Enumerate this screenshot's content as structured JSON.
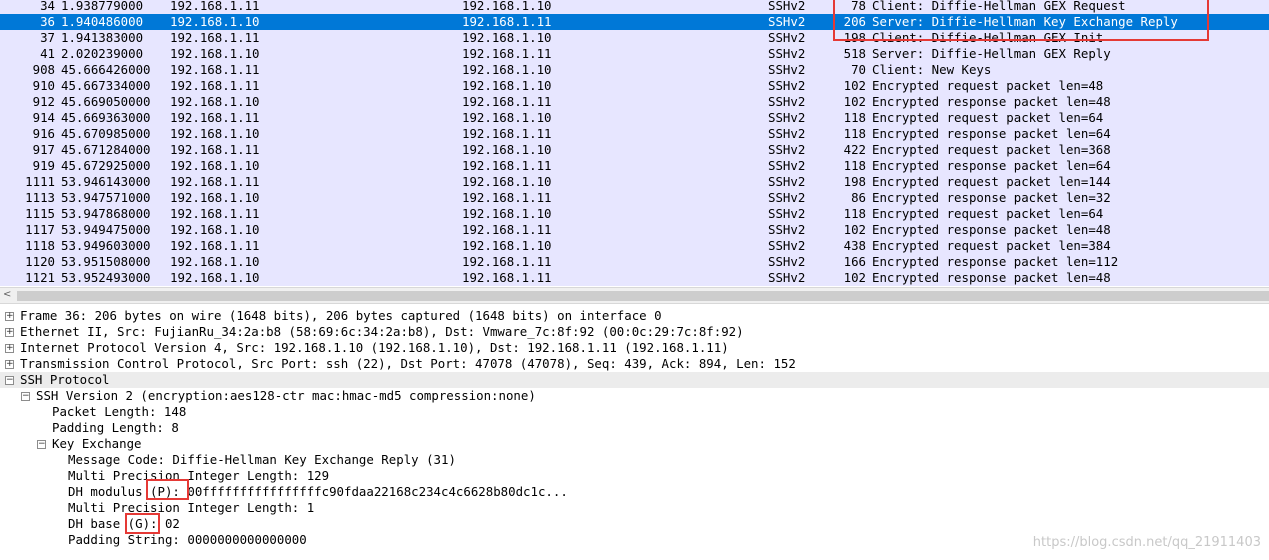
{
  "packets": [
    {
      "no": "34",
      "time": "1.938779000",
      "src": "192.168.1.11",
      "dst": "192.168.1.10",
      "proto": "SSHv2",
      "len": "78",
      "info": "Client: Diffie-Hellman GEX Request"
    },
    {
      "no": "36",
      "time": "1.940486000",
      "src": "192.168.1.10",
      "dst": "192.168.1.11",
      "proto": "SSHv2",
      "len": "206",
      "info": "Server: Diffie-Hellman Key Exchange Reply",
      "selected": true
    },
    {
      "no": "37",
      "time": "1.941383000",
      "src": "192.168.1.11",
      "dst": "192.168.1.10",
      "proto": "SSHv2",
      "len": "198",
      "info": "Client: Diffie-Hellman GEX Init"
    },
    {
      "no": "41",
      "time": "2.020239000",
      "src": "192.168.1.10",
      "dst": "192.168.1.11",
      "proto": "SSHv2",
      "len": "518",
      "info": "Server: Diffie-Hellman GEX Reply"
    },
    {
      "no": "908",
      "time": "45.666426000",
      "src": "192.168.1.11",
      "dst": "192.168.1.10",
      "proto": "SSHv2",
      "len": "70",
      "info": "Client: New Keys"
    },
    {
      "no": "910",
      "time": "45.667334000",
      "src": "192.168.1.11",
      "dst": "192.168.1.10",
      "proto": "SSHv2",
      "len": "102",
      "info": "Encrypted request packet len=48"
    },
    {
      "no": "912",
      "time": "45.669050000",
      "src": "192.168.1.10",
      "dst": "192.168.1.11",
      "proto": "SSHv2",
      "len": "102",
      "info": "Encrypted response packet len=48"
    },
    {
      "no": "914",
      "time": "45.669363000",
      "src": "192.168.1.11",
      "dst": "192.168.1.10",
      "proto": "SSHv2",
      "len": "118",
      "info": "Encrypted request packet len=64"
    },
    {
      "no": "916",
      "time": "45.670985000",
      "src": "192.168.1.10",
      "dst": "192.168.1.11",
      "proto": "SSHv2",
      "len": "118",
      "info": "Encrypted response packet len=64"
    },
    {
      "no": "917",
      "time": "45.671284000",
      "src": "192.168.1.11",
      "dst": "192.168.1.10",
      "proto": "SSHv2",
      "len": "422",
      "info": "Encrypted request packet len=368"
    },
    {
      "no": "919",
      "time": "45.672925000",
      "src": "192.168.1.10",
      "dst": "192.168.1.11",
      "proto": "SSHv2",
      "len": "118",
      "info": "Encrypted response packet len=64"
    },
    {
      "no": "1111",
      "time": "53.946143000",
      "src": "192.168.1.11",
      "dst": "192.168.1.10",
      "proto": "SSHv2",
      "len": "198",
      "info": "Encrypted request packet len=144"
    },
    {
      "no": "1113",
      "time": "53.947571000",
      "src": "192.168.1.10",
      "dst": "192.168.1.11",
      "proto": "SSHv2",
      "len": "86",
      "info": "Encrypted response packet len=32"
    },
    {
      "no": "1115",
      "time": "53.947868000",
      "src": "192.168.1.11",
      "dst": "192.168.1.10",
      "proto": "SSHv2",
      "len": "118",
      "info": "Encrypted request packet len=64"
    },
    {
      "no": "1117",
      "time": "53.949475000",
      "src": "192.168.1.10",
      "dst": "192.168.1.11",
      "proto": "SSHv2",
      "len": "102",
      "info": "Encrypted response packet len=48"
    },
    {
      "no": "1118",
      "time": "53.949603000",
      "src": "192.168.1.11",
      "dst": "192.168.1.10",
      "proto": "SSHv2",
      "len": "438",
      "info": "Encrypted request packet len=384"
    },
    {
      "no": "1120",
      "time": "53.951508000",
      "src": "192.168.1.10",
      "dst": "192.168.1.11",
      "proto": "SSHv2",
      "len": "166",
      "info": "Encrypted response packet len=112"
    },
    {
      "no": "1121",
      "time": "53.952493000",
      "src": "192.168.1.10",
      "dst": "192.168.1.11",
      "proto": "SSHv2",
      "len": "102",
      "info": "Encrypted response packet len=48"
    }
  ],
  "scrollbar": {
    "left_arrow": "<"
  },
  "details": {
    "frame": "Frame 36: 206 bytes on wire (1648 bits), 206 bytes captured (1648 bits) on interface 0",
    "ethernet": "Ethernet II, Src: FujianRu_34:2a:b8 (58:69:6c:34:2a:b8), Dst: Vmware_7c:8f:92 (00:0c:29:7c:8f:92)",
    "ip": "Internet Protocol Version 4, Src: 192.168.1.10 (192.168.1.10), Dst: 192.168.1.11 (192.168.1.11)",
    "tcp": "Transmission Control Protocol, Src Port: ssh (22), Dst Port: 47078 (47078), Seq: 439, Ack: 894, Len: 152",
    "ssh": "SSH Protocol",
    "ssh_version": "SSH Version 2 (encryption:aes128-ctr mac:hmac-md5 compression:none)",
    "packet_length": "Packet Length: 148",
    "padding_length": "Padding Length: 8",
    "key_exchange": "Key Exchange",
    "message_code": "Message Code: Diffie-Hellman Key Exchange Reply (31)",
    "mpi_length_1": "Multi Precision Integer Length: 129",
    "dh_modulus": "DH modulus (P): 00ffffffffffffffffc90fdaa22168c234c4c6628b80dc1c...",
    "mpi_length_2": "Multi Precision Integer Length: 1",
    "dh_base": "DH base (G): 02",
    "padding_string": "Padding String: 0000000000000000"
  },
  "watermark": "https://blog.csdn.net/qq_21911403",
  "colors": {
    "row_bg": "#e7e6ff",
    "selected_bg": "#0078d7",
    "highlight_box": "#e53935"
  }
}
